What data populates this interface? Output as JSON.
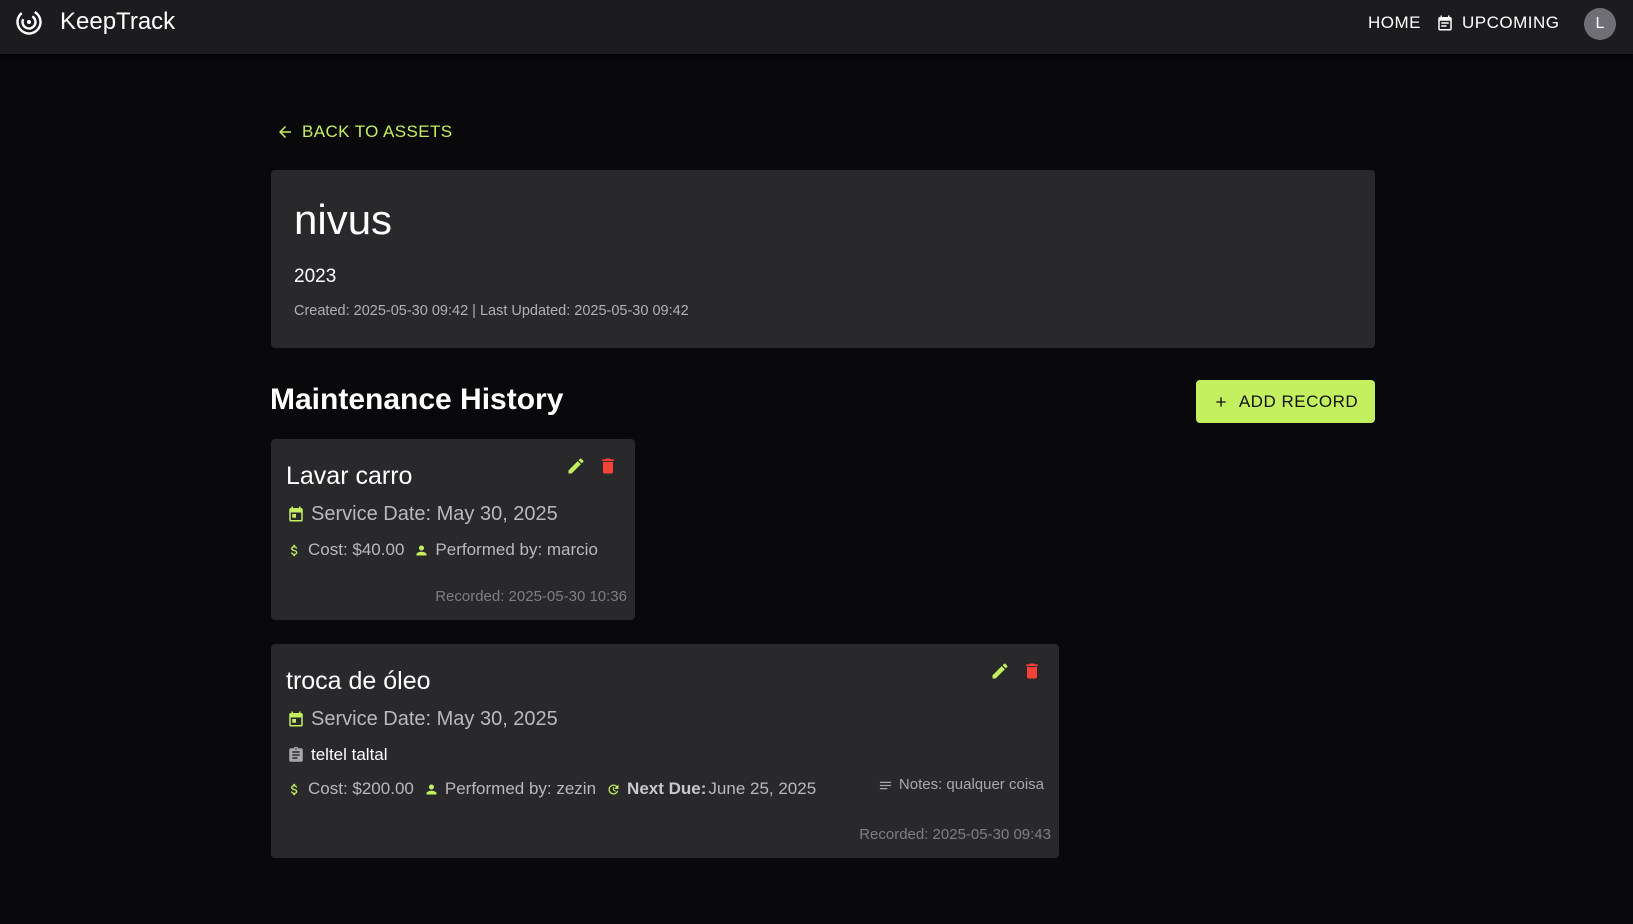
{
  "app": {
    "name": "KeepTrack",
    "nav": {
      "home": "HOME",
      "upcoming": "UPCOMING"
    },
    "avatar_initial": "L"
  },
  "back_link": "BACK TO ASSETS",
  "asset": {
    "name": "nivus",
    "year": "2023",
    "meta": "Created: 2025-05-30 09:42 | Last Updated: 2025-05-30 09:42"
  },
  "history": {
    "title": "Maintenance History",
    "add_label": "ADD RECORD",
    "records": [
      {
        "title": "Lavar carro",
        "service_date": "Service Date: May 30, 2025",
        "cost": "Cost: $40.00",
        "performed_by": "Performed by: marcio",
        "recorded": "Recorded: 2025-05-30 10:36"
      },
      {
        "title": "troca de óleo",
        "service_date": "Service Date: May 30, 2025",
        "description": "teltel taltal",
        "cost": "Cost: $200.00",
        "performed_by": "Performed by: zezin",
        "next_due_label": "Next Due:",
        "next_due": "June 25, 2025",
        "notes": "Notes: qualquer coisa",
        "recorded": "Recorded: 2025-05-30 09:43"
      }
    ]
  },
  "colors": {
    "accent": "#c4f060",
    "danger": "#f44336",
    "background": "#09090b",
    "card": "#29292c",
    "appbar": "#1c1c1e"
  }
}
